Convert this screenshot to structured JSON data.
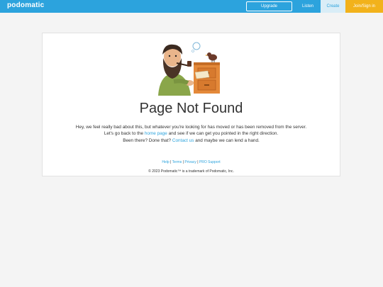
{
  "header": {
    "logo_text": "podomatic",
    "upgrade_label": "Upgrade",
    "nav": {
      "listen": "Listen",
      "create": "Create",
      "join_signin": "Join/Sign in"
    }
  },
  "main": {
    "title": "Page Not Found",
    "line1": "Hey, we feel really bad about this, but whatever you're looking for has moved or has been removed from the server.",
    "line2_pre": "Let's go back to the",
    "line2_link": "home page",
    "line2_post": "and see if we can get you pointed in the right direction.",
    "line3_pre": "Been there? Done that?",
    "line3_link": "Contact us",
    "line3_post": "and maybe we can lend a hand."
  },
  "footer": {
    "links": [
      "Help",
      "Terms",
      "Privacy",
      "PRO Support"
    ],
    "separator": "|",
    "copyright": "© 2023 Podomatic™ is a trademark of Podomatic, Inc."
  },
  "colors": {
    "brand_blue": "#2ca3dd",
    "join_orange": "#f2b21b",
    "create_bg": "#d9edf7"
  }
}
